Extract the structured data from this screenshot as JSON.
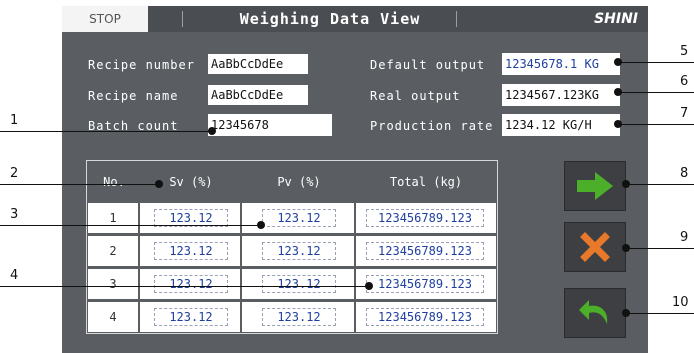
{
  "header": {
    "stop_label": "STOP",
    "title": "Weighing Data View",
    "logo_text": "SHINI"
  },
  "info": {
    "recipe_number_label": "Recipe number",
    "recipe_number_value": "AaBbCcDdEe",
    "recipe_name_label": "Recipe name",
    "recipe_name_value": "AaBbCcDdEe",
    "batch_count_label": "Batch count",
    "batch_count_value": "12345678",
    "default_output_label": "Default output",
    "default_output_value": "12345678.1 KG",
    "real_output_label": "Real output",
    "real_output_value": "1234567.123KG",
    "production_rate_label": "Production rate",
    "production_rate_value": "1234.12 KG/H"
  },
  "table": {
    "headers": [
      "No.",
      "Sv (%)",
      "Pv (%)",
      "Total (kg)"
    ],
    "rows": [
      {
        "no": "1",
        "sv": "123.12",
        "pv": "123.12",
        "total": "123456789.123"
      },
      {
        "no": "2",
        "sv": "123.12",
        "pv": "123.12",
        "total": "123456789.123"
      },
      {
        "no": "3",
        "sv": "123.12",
        "pv": "123.12",
        "total": "123456789.123"
      },
      {
        "no": "4",
        "sv": "123.12",
        "pv": "123.12",
        "total": "123456789.123"
      }
    ]
  },
  "buttons": {
    "next_icon": "right-arrow-icon",
    "clear_icon": "x-icon",
    "back_icon": "return-arrow-icon",
    "next_color": "#4caf2a",
    "clear_color": "#e8782a",
    "back_color": "#4caf2a"
  },
  "callouts": [
    "1",
    "2",
    "3",
    "4",
    "5",
    "6",
    "7",
    "8",
    "9",
    "10"
  ]
}
